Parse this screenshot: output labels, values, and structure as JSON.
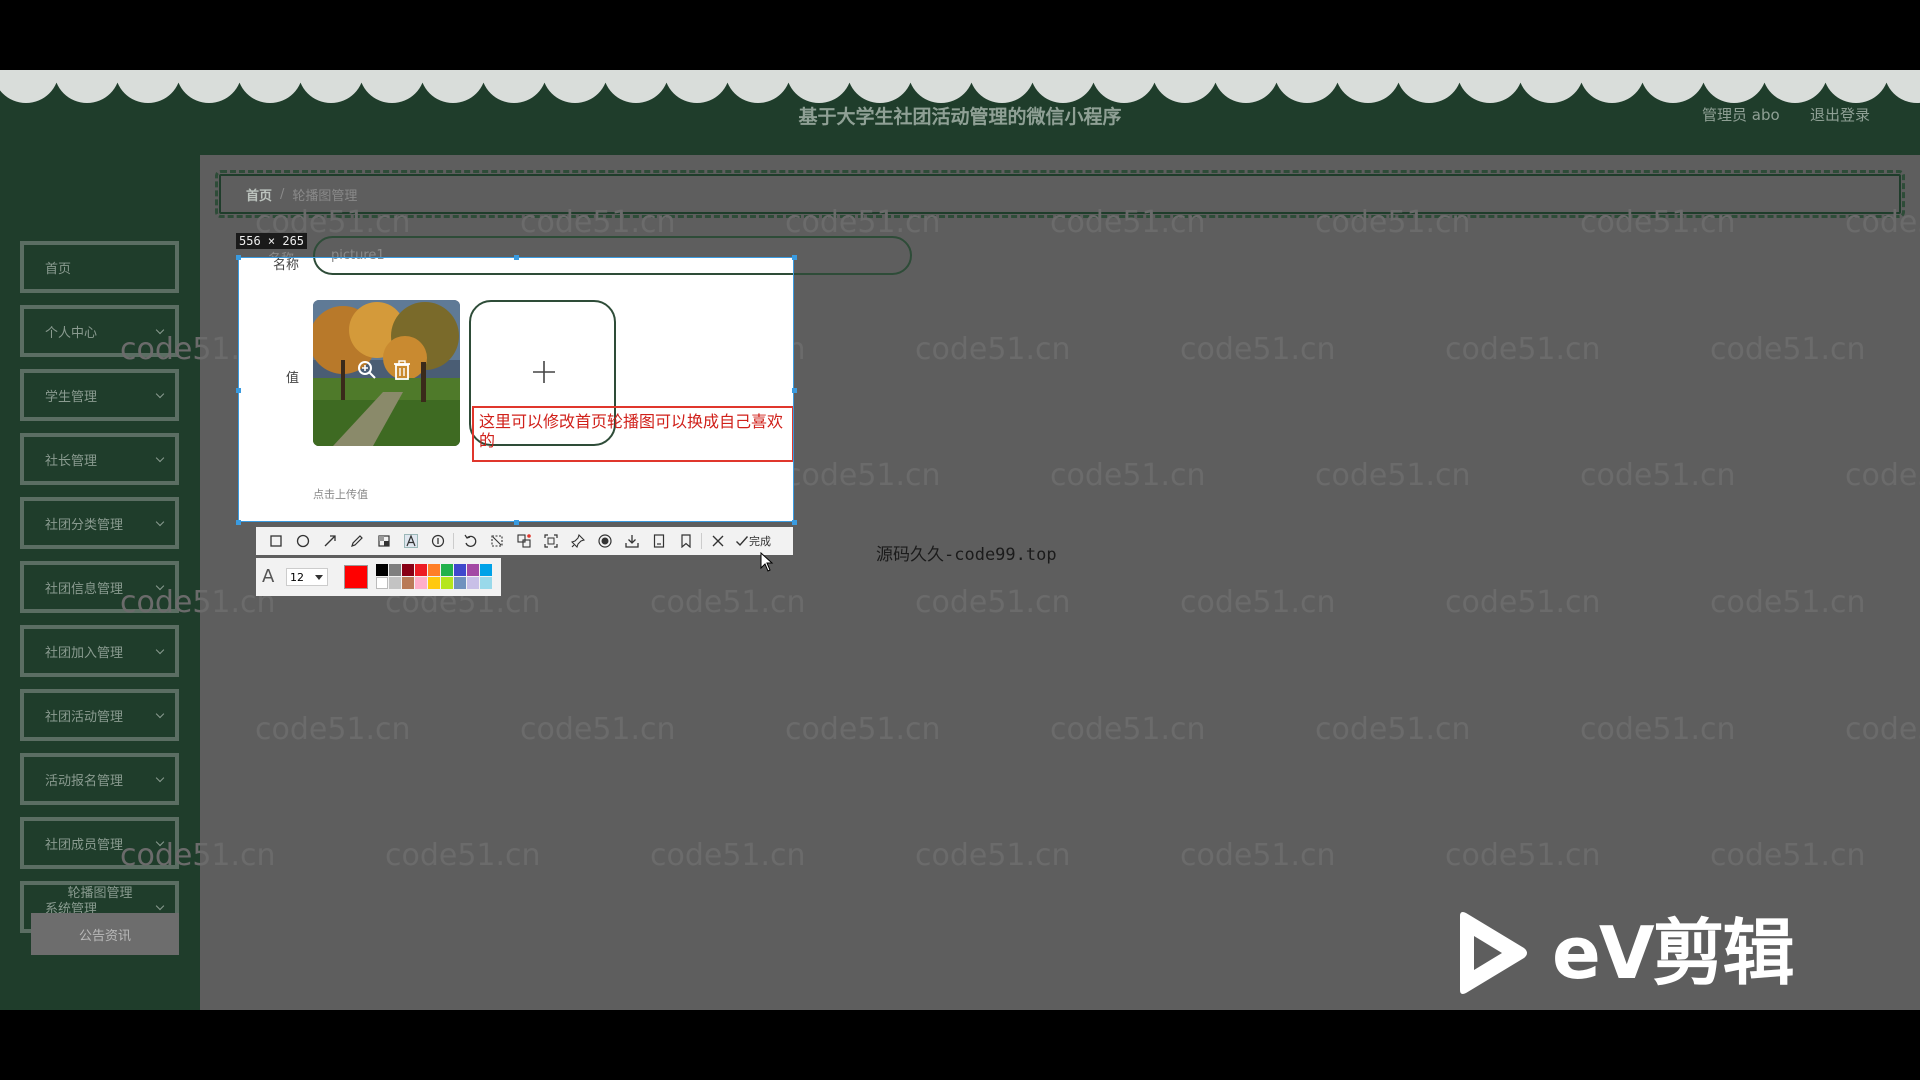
{
  "header": {
    "title": "基于大学生社团活动管理的微信小程序",
    "user_label": "管理员 abo",
    "logout_label": "退出登录"
  },
  "sidebar": {
    "items": [
      {
        "label": "首页",
        "has_chevron": false
      },
      {
        "label": "个人中心",
        "has_chevron": true
      },
      {
        "label": "学生管理",
        "has_chevron": true
      },
      {
        "label": "社长管理",
        "has_chevron": true
      },
      {
        "label": "社团分类管理",
        "has_chevron": true
      },
      {
        "label": "社团信息管理",
        "has_chevron": true
      },
      {
        "label": "社团加入管理",
        "has_chevron": true
      },
      {
        "label": "社团活动管理",
        "has_chevron": true
      },
      {
        "label": "活动报名管理",
        "has_chevron": true
      },
      {
        "label": "社团成员管理",
        "has_chevron": true
      },
      {
        "label": "系统管理",
        "has_chevron": true
      }
    ],
    "submenu": {
      "banner_label": "轮播图管理",
      "notice_label": "公告资讯"
    }
  },
  "breadcrumb": {
    "home": "首页",
    "separator": "/",
    "current": "轮播图管理"
  },
  "form": {
    "name_label": "名称",
    "name_value": "picture1",
    "value_label": "值",
    "upload_hint": "点击上传值"
  },
  "capture": {
    "size_label": "556 × 265",
    "annotation_text": "这里可以修改首页轮播图可以换成自己喜欢的"
  },
  "toolbar": {
    "done_label": "完成",
    "tools": [
      "rectangle-icon",
      "ellipse-icon",
      "arrow-icon",
      "pencil-icon",
      "mosaic-icon",
      "text-icon",
      "serial-number-icon",
      "undo-icon",
      "redo-icon",
      "ocr-icon",
      "pin-region-icon",
      "pin-icon",
      "record-icon",
      "download-icon",
      "save-icon",
      "bookmark-icon"
    ],
    "font_size": "12",
    "current_color": "#ff0000",
    "palette": [
      "#000000",
      "#7f7f7f",
      "#880015",
      "#ed1c24",
      "#ff7f27",
      "#22b14c",
      "#3f48cc",
      "#a349a4",
      "#00a2e8",
      "#ffffff",
      "#c3c3c3",
      "#b97a57",
      "#ffaec9",
      "#ffc90e",
      "#b5e61d",
      "#7092be",
      "#c8bfe7",
      "#99d9ea"
    ]
  },
  "overlay_text": "源码久久-code99.top",
  "watermark_text": "code51.cn",
  "logo_text": "eV剪辑",
  "colors": {
    "header_bg": "#1f3d2b",
    "content_bg": "#5e5e5e",
    "annotation": "#e0362c",
    "selection_border": "#3a9be0"
  }
}
